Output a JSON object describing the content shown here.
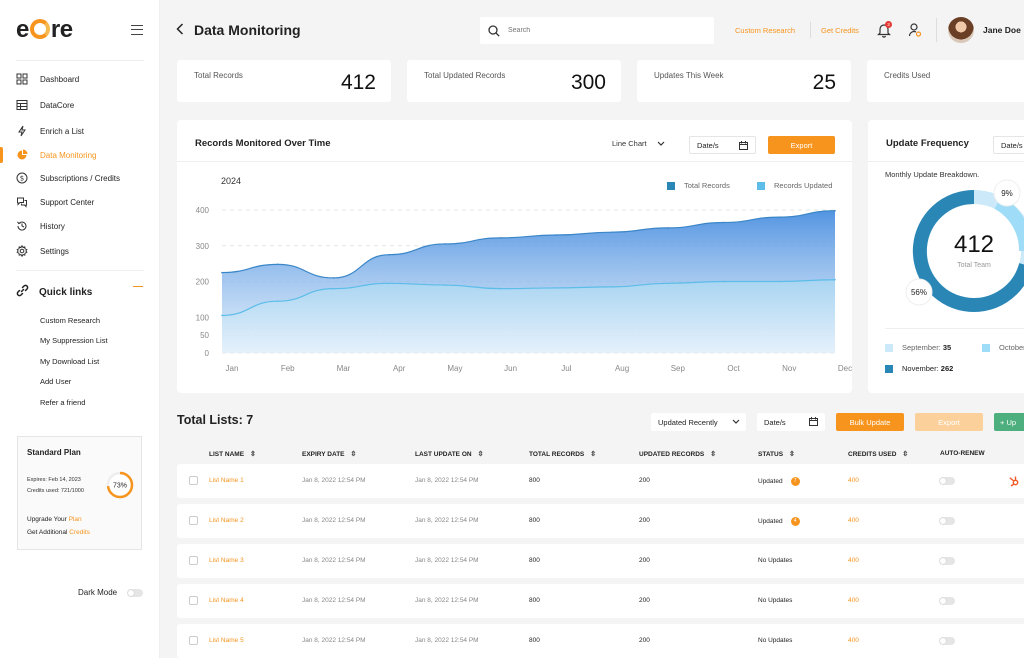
{
  "brand": {
    "logo_left": "e",
    "logo_right": "re"
  },
  "sidebar": {
    "items": [
      {
        "label": "Dashboard"
      },
      {
        "label": "DataCore"
      },
      {
        "label": "Enrich a List"
      },
      {
        "label": "Data Monitoring",
        "active": true
      },
      {
        "label": "Subscriptions / Credits"
      },
      {
        "label": "Support Center"
      },
      {
        "label": "History"
      },
      {
        "label": "Settings"
      }
    ],
    "quick_links_title": "Quick links",
    "quick_links": [
      "Custom Research",
      "My Suppression List",
      "My Download List",
      "Add User",
      "Refer a friend"
    ],
    "plan": {
      "title": "Standard Plan",
      "expires": "Expires: Feb 14, 2023",
      "credits_used": "Credits used: 721/1000",
      "percent_label": "73%",
      "percent": 0.73,
      "upgrade_prefix": "Upgrade Your",
      "upgrade_link": "Plan",
      "additional_prefix": "Get Additional",
      "additional_link": "Credits"
    },
    "dark_mode_label": "Dark Mode"
  },
  "header": {
    "title": "Data Monitoring",
    "search_placeholder": "Search",
    "links": [
      "Custom Research",
      "Get Credits"
    ],
    "notification_count": "3",
    "user_name": "Jane Doe"
  },
  "stats": [
    {
      "label": "Total Records",
      "value": "412"
    },
    {
      "label": "Total Updated Records",
      "value": "300"
    },
    {
      "label": "Updates This Week",
      "value": "25"
    },
    {
      "label": "Credits Used",
      "value": ""
    }
  ],
  "chart_panel": {
    "title": "Records Monitored Over Time",
    "chart_type_select": "Line Chart",
    "date_label": "Date/s",
    "export_label": "Export"
  },
  "chart_data": {
    "type": "area",
    "title": "2024",
    "categories": [
      "Jan",
      "Feb",
      "Mar",
      "Apr",
      "May",
      "Jun",
      "Jul",
      "Aug",
      "Sep",
      "Oct",
      "Nov",
      "Dec"
    ],
    "series": [
      {
        "name": "Total Records",
        "color": "#3a86c8",
        "values": [
          225,
          248,
          210,
          275,
          305,
          322,
          330,
          338,
          350,
          365,
          380,
          398
        ]
      },
      {
        "name": "Records Updated",
        "color": "#5bbde8",
        "values": [
          105,
          145,
          180,
          195,
          190,
          180,
          182,
          185,
          195,
          200,
          200,
          205
        ]
      }
    ],
    "ylim": [
      0,
      400
    ],
    "yticks": [
      0,
      50,
      100,
      200,
      300,
      400
    ],
    "grid": true,
    "legend": "top-right"
  },
  "freq_panel": {
    "title": "Update Frequency",
    "date_label": "Date/s",
    "subtitle": "Monthly Update Breakdown.",
    "center_value": "412",
    "center_label": "Total Team",
    "pct_a": "9%",
    "pct_b": "56%",
    "legend": [
      {
        "name": "September:",
        "value": "35",
        "color": "#cbe9f8"
      },
      {
        "name": "October",
        "value": "",
        "color": "#9fdcf7"
      },
      {
        "name": "November:",
        "value": "262",
        "color": "#2a86b5"
      }
    ]
  },
  "lists": {
    "title": "Total Lists: 7",
    "sort_select": "Updated Recently",
    "date_label": "Date/s",
    "bulk_update_label": "Bulk Update",
    "export_label": "Export",
    "upload_label": "+ Up",
    "columns": [
      "LIST NAME",
      "EXPIRY DATE",
      "LAST UPDATE ON",
      "TOTAL RECORDS",
      "UPDATED RECORDS",
      "STATUS",
      "CREDITS USED",
      "AUTO-RENEW"
    ],
    "rows": [
      {
        "name": "List Name 1",
        "expiry": "Jan 8, 2022   12:54 PM",
        "last_update": "Jan 8, 2022   12:54 PM",
        "total": "800",
        "updated": "200",
        "status": "Updated",
        "status_badge": "7",
        "credits": "400"
      },
      {
        "name": "List Name 2",
        "expiry": "Jan 8, 2022   12:54 PM",
        "last_update": "Jan 8, 2022   12:54 PM",
        "total": "800",
        "updated": "200",
        "status": "Updated",
        "status_badge": "4",
        "credits": "400"
      },
      {
        "name": "List Name 3",
        "expiry": "Jan 8, 2022   12:54 PM",
        "last_update": "Jan 8, 2022   12:54 PM",
        "total": "800",
        "updated": "200",
        "status": "No Updates",
        "status_badge": "",
        "credits": "400"
      },
      {
        "name": "List Name 4",
        "expiry": "Jan 8, 2022   12:54 PM",
        "last_update": "Jan 8, 2022   12:54 PM",
        "total": "800",
        "updated": "200",
        "status": "No Updates",
        "status_badge": "",
        "credits": "400"
      },
      {
        "name": "List Name 5",
        "expiry": "Jan 8, 2022   12:54 PM",
        "last_update": "Jan 8, 2022   12:54 PM",
        "total": "800",
        "updated": "200",
        "status": "No Updates",
        "status_badge": "",
        "credits": "400"
      }
    ]
  }
}
